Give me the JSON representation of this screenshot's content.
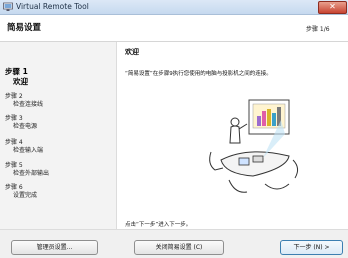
{
  "window": {
    "title": "Virtual Remote Tool",
    "close_label": "✕"
  },
  "header": {
    "title": "简易设置",
    "step_counter": "步骤 1/6"
  },
  "sidebar": {
    "items": [
      {
        "label": "步骤 1",
        "name": "欢迎",
        "active": true
      },
      {
        "label": "步骤 2",
        "name": "检查连接线"
      },
      {
        "label": "步骤 3",
        "name": "检查电源"
      },
      {
        "label": "步骤 4",
        "name": "检查输入端"
      },
      {
        "label": "步骤 5",
        "name": "检查外部输出"
      },
      {
        "label": "步骤 6",
        "name": "设置完成"
      }
    ]
  },
  "content": {
    "heading": "欢迎",
    "description": "“简易设置”在步骤9执行您使用的电脑与投影机之间的连接。",
    "hint": "点击“下一步”进入下一步。"
  },
  "footer": {
    "admin_button": "管理员设置...",
    "close_setup_button": "关闭简易设置 (C)",
    "next_button": "下一步 (N) >"
  },
  "colors": {
    "accent": "#3c7fb1",
    "close": "#c84432"
  }
}
